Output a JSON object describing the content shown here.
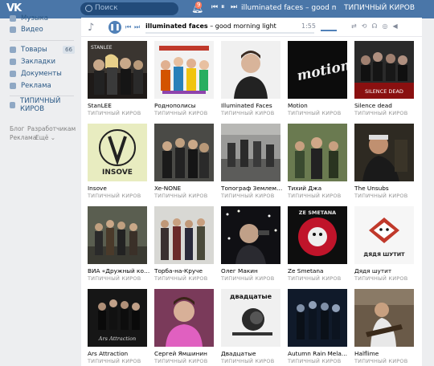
{
  "topbar": {
    "logo": "VK",
    "search_placeholder": "Поиск",
    "notifications_count": "9",
    "track": "illuminated faces – good morning ligh",
    "right_text": "ТИПИЧНЫЙ КИРОВ"
  },
  "sidebar": {
    "items": [
      {
        "label": "Музыка",
        "icon": "music-icon"
      },
      {
        "label": "Видео",
        "icon": "video-icon"
      },
      {
        "label": "Товары",
        "icon": "shop-icon"
      },
      {
        "label": "Закладки",
        "icon": "bookmark-icon"
      },
      {
        "label": "Документы",
        "icon": "document-icon"
      },
      {
        "label": "Реклама",
        "icon": "ads-icon"
      },
      {
        "label": "ТИПИЧНЫЙ КИРОВ",
        "icon": "group-icon"
      }
    ],
    "goods_count": "66",
    "footer": [
      "Блог",
      "Разработчикам",
      "Реклама",
      "Ещё ⌄"
    ]
  },
  "player": {
    "artist": "illuminated faces",
    "song": " – good morning light",
    "time": "1:55",
    "progress": 0.0
  },
  "cards": [
    {
      "title": "StanLEE",
      "sub": "ТИПИЧНЫЙ КИРОВ"
    },
    {
      "title": "Роднополисы",
      "sub": "ТИПИЧНЫЙ КИРОВ"
    },
    {
      "title": "Illuminated Faces",
      "sub": "ТИПИЧНЫЙ КИРОВ"
    },
    {
      "title": "Motion",
      "sub": "ТИПИЧНЫЙ КИРОВ"
    },
    {
      "title": "Silence dead",
      "sub": "ТИПИЧНЫЙ КИРОВ"
    },
    {
      "title": "Insove",
      "sub": "ТИПИЧНЫЙ КИРОВ"
    },
    {
      "title": "Xe-NONE",
      "sub": "ТИПИЧНЫЙ КИРОВ"
    },
    {
      "title": "Топограф Землемер",
      "sub": "ТИПИЧНЫЙ КИРОВ"
    },
    {
      "title": "Тихий Джа",
      "sub": "ТИПИЧНЫЙ КИРОВ"
    },
    {
      "title": "The Unsubs",
      "sub": "ТИПИЧНЫЙ КИРОВ"
    },
    {
      "title": "ВИА «Дружный колл…",
      "sub": "ТИПИЧНЫЙ КИРОВ"
    },
    {
      "title": "Торба-на-Круче",
      "sub": "ТИПИЧНЫЙ КИРОВ"
    },
    {
      "title": "Олег Макин",
      "sub": "ТИПИЧНЫЙ КИРОВ"
    },
    {
      "title": "Ze Smetana",
      "sub": "ТИПИЧНЫЙ КИРОВ"
    },
    {
      "title": "Дядя шутит",
      "sub": "ТИПИЧНЫЙ КИРОВ"
    },
    {
      "title": "Ars Attraction",
      "sub": "ТИПИЧНЫЙ КИРОВ"
    },
    {
      "title": "Сергей Ямшинин",
      "sub": "ТИПИЧНЫЙ КИРОВ"
    },
    {
      "title": "Двадцатые",
      "sub": "ТИПИЧНЫЙ КИРОВ"
    },
    {
      "title": "Autumn Rain Melanch…",
      "sub": "ТИПИЧНЫЙ КИРОВ"
    },
    {
      "title": "Halflime",
      "sub": "ТИПИЧНЫЙ КИРОВ"
    }
  ],
  "cover_text": {
    "stanlee": "STANLEE",
    "silence": "SILENCE DEAD",
    "motion": "motion",
    "insove": "INSOVE",
    "zesmetana": "ZE SMETANA",
    "djadja": "ДЯДЯ ШУТИТ",
    "ars": "Ars Attraction",
    "dvadcatye": "двадцатые"
  },
  "colors": {
    "header": "#4a76a8",
    "link": "#2a5885",
    "accent": "#5181b8"
  }
}
